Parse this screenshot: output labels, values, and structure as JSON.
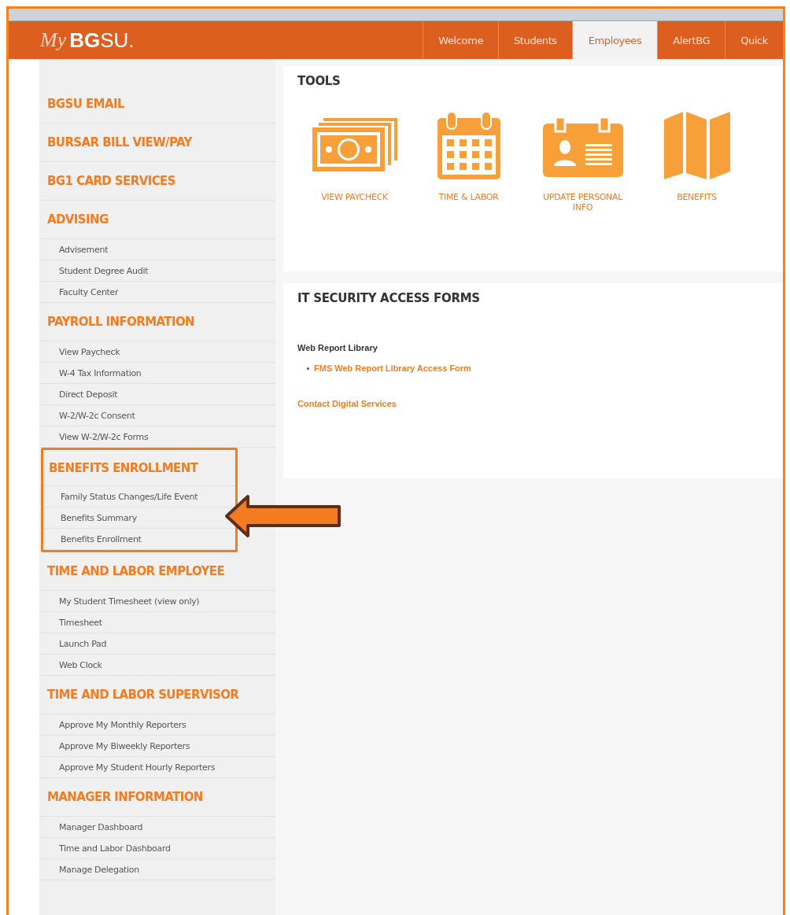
{
  "header": {
    "logo_script": "My",
    "logo_bold": "BG",
    "logo_rest": "SU.",
    "tabs": [
      {
        "label": "Welcome",
        "selected": false
      },
      {
        "label": "Students",
        "selected": false
      },
      {
        "label": "Employees",
        "selected": true
      },
      {
        "label": "AlertBG",
        "selected": false
      },
      {
        "label": "Quick",
        "selected": false
      }
    ]
  },
  "sidebar": {
    "sections": [
      {
        "heading": "BGSU EMAIL",
        "highlighted": false
      },
      {
        "heading": "BURSAR BILL VIEW/PAY",
        "highlighted": false
      },
      {
        "heading": "BG1 CARD SERVICES",
        "highlighted": false
      },
      {
        "heading": "ADVISING",
        "highlighted": false,
        "items": [
          "Advisement",
          "Student Degree Audit",
          "Faculty Center"
        ]
      },
      {
        "heading": "PAYROLL INFORMATION",
        "highlighted": false,
        "items": [
          "View Paycheck",
          "W-4 Tax Information",
          "Direct Deposit",
          "W-2/W-2c Consent",
          "View W-2/W-2c Forms"
        ]
      },
      {
        "heading": "BENEFITS ENROLLMENT",
        "highlighted": true,
        "items": [
          "Family Status Changes/Life Event",
          "Benefits Summary",
          "Benefits Enrollment"
        ]
      },
      {
        "heading": "TIME AND LABOR EMPLOYEE",
        "highlighted": false,
        "items": [
          "My Student Timesheet (view only)",
          "Timesheet",
          "Launch Pad",
          "Web Clock"
        ]
      },
      {
        "heading": "TIME AND LABOR SUPERVISOR",
        "highlighted": false,
        "items": [
          "Approve My Monthly Reporters",
          "Approve My Biweekly Reporters",
          "Approve My Student Hourly Reporters"
        ]
      },
      {
        "heading": "MANAGER INFORMATION",
        "highlighted": false,
        "items": [
          "Manager Dashboard",
          "Time and Labor Dashboard",
          "Manage Delegation"
        ]
      }
    ]
  },
  "tools": {
    "title": "TOOLS",
    "tiles": [
      {
        "kind": "money",
        "label": "VIEW PAYCHECK"
      },
      {
        "kind": "calendar",
        "label": "TIME & LABOR"
      },
      {
        "kind": "badge",
        "label": "UPDATE PERSONAL INFO"
      },
      {
        "kind": "map",
        "label": "BENEFITS"
      }
    ]
  },
  "security": {
    "title": "IT SECURITY ACCESS FORMS",
    "subheading": "Web Report Library",
    "links": [
      "FMS Web Report Library Access Form"
    ],
    "contact": "Contact Digital Services"
  }
}
